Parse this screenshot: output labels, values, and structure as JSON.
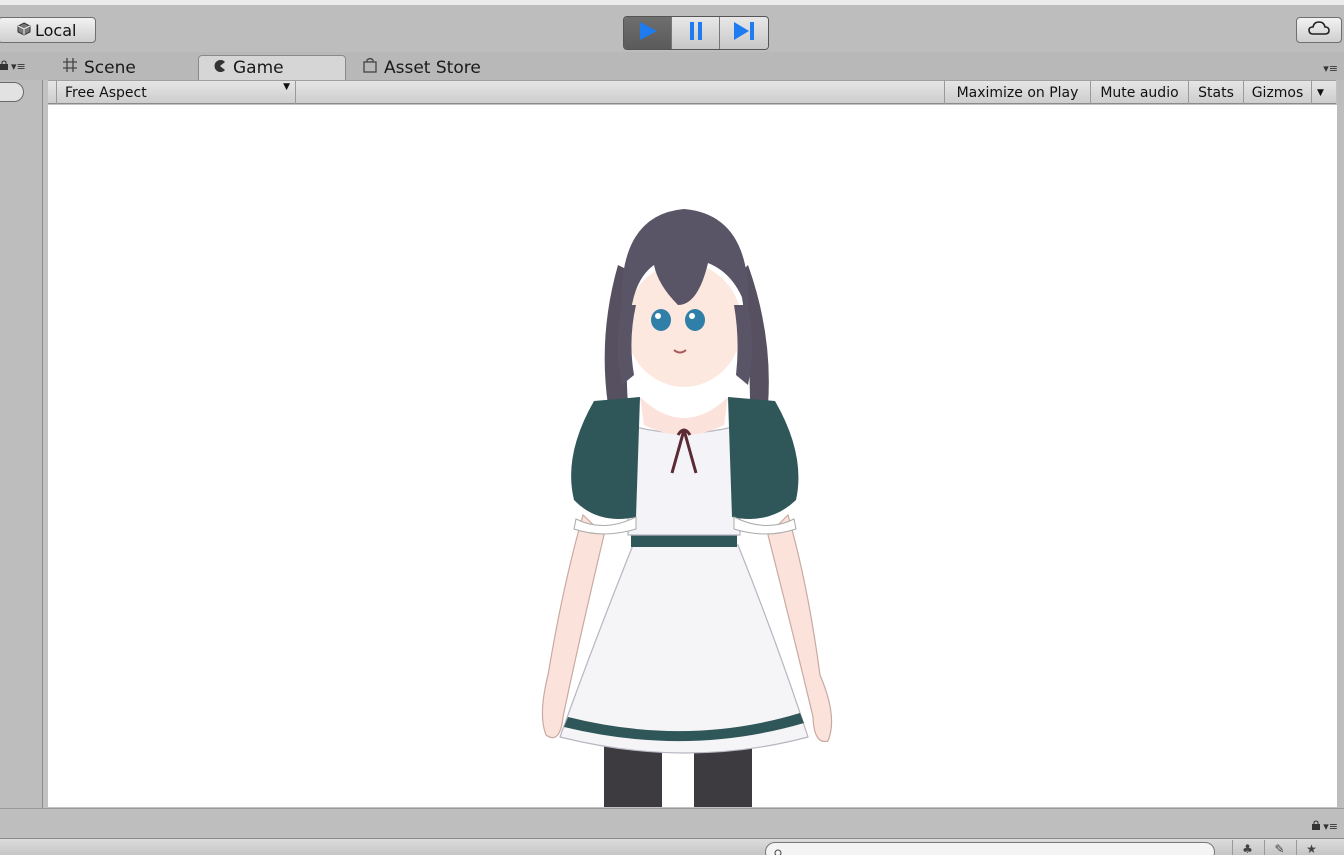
{
  "toolbar": {
    "local_label": "Local",
    "play_icon": "play-icon",
    "pause_icon": "pause-icon",
    "step_icon": "step-icon",
    "cloud_icon": "cloud-icon"
  },
  "tabs": [
    {
      "label": "Scene",
      "icon": "grid-icon",
      "active": false
    },
    {
      "label": "Game",
      "icon": "pacman-icon",
      "active": true
    },
    {
      "label": "Asset Store",
      "icon": "store-icon",
      "active": false
    }
  ],
  "game_toolbar": {
    "aspect": "Free Aspect",
    "maximize": "Maximize on Play",
    "mute": "Mute audio",
    "stats": "Stats",
    "gizmos": "Gizmos"
  },
  "colors": {
    "accent_blue": "#1f7bf0",
    "dress_green": "#2f5658",
    "hair": "#5a5566"
  }
}
